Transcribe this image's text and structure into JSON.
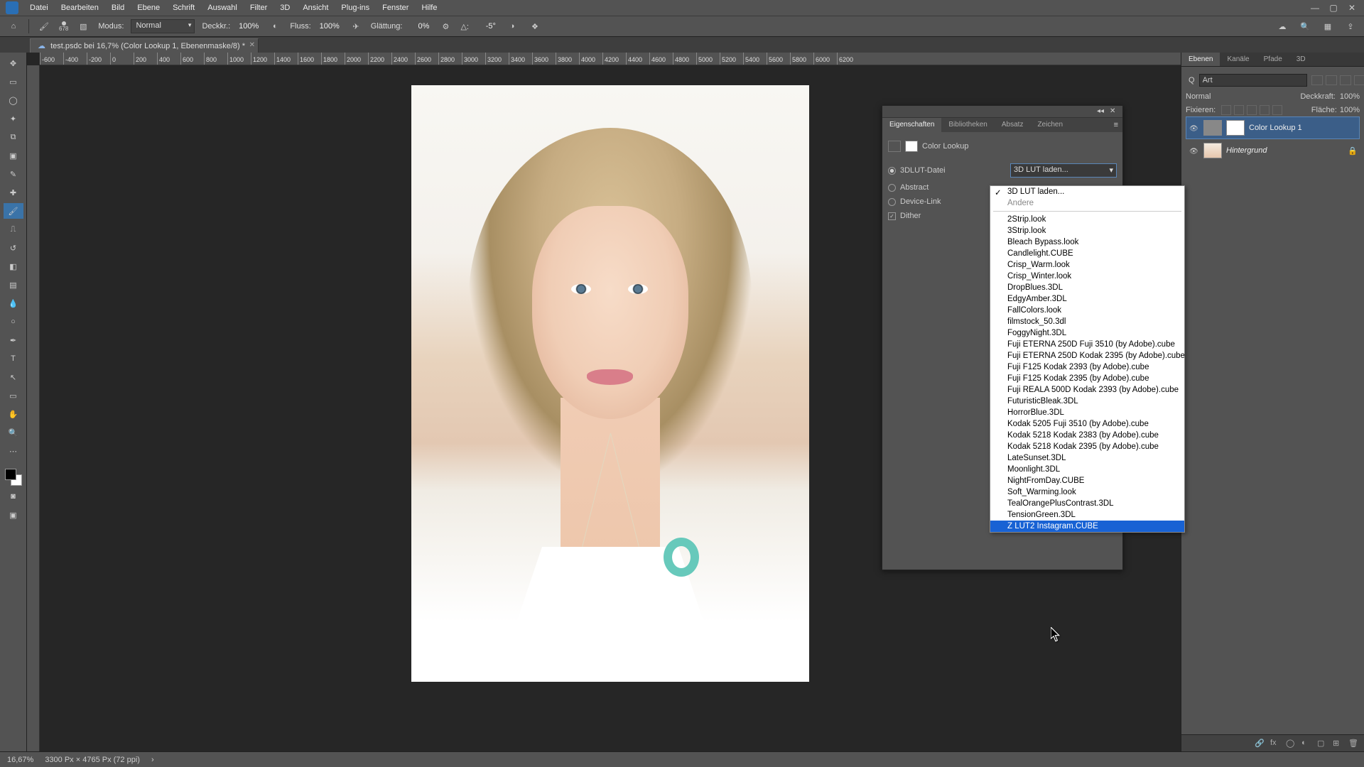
{
  "menu": [
    "Datei",
    "Bearbeiten",
    "Bild",
    "Ebene",
    "Schrift",
    "Auswahl",
    "Filter",
    "3D",
    "Ansicht",
    "Plug-ins",
    "Fenster",
    "Hilfe"
  ],
  "optbar": {
    "brush_size": "678",
    "modus_label": "Modus:",
    "modus_value": "Normal",
    "deckkr_label": "Deckkr.:",
    "deckkr_value": "100%",
    "fluss_label": "Fluss:",
    "fluss_value": "100%",
    "glatt_label": "Glättung:",
    "glatt_value": "0%",
    "angle_label": "△:",
    "angle_value": "-5°"
  },
  "doctab": {
    "title": "test.psdc bei 16,7% (Color Lookup 1, Ebenenmaske/8) *"
  },
  "ruler_ticks": [
    "-600",
    "-400",
    "-200",
    "0",
    "200",
    "400",
    "600",
    "800",
    "1000",
    "1200",
    "1400",
    "1600",
    "1800",
    "2000",
    "2200",
    "2400",
    "2600",
    "2800",
    "3000",
    "3200",
    "3400",
    "3600",
    "3800",
    "4000",
    "4200",
    "4400",
    "4600",
    "4800",
    "5000",
    "5200",
    "5400",
    "5600",
    "5800",
    "6000",
    "6200"
  ],
  "props": {
    "tab1": "Eigenschaften",
    "tab2": "Bibliotheken",
    "tab3": "Absatz",
    "tab4": "Zeichen",
    "title": "Color Lookup",
    "r1": "3DLUT-Datei",
    "r2": "Abstract",
    "r3": "Device-Link",
    "r4": "Dither",
    "dd_label": "3D LUT laden..."
  },
  "lut_menu": {
    "load": "3D LUT laden...",
    "other": "Andere",
    "items": [
      "2Strip.look",
      "3Strip.look",
      "Bleach Bypass.look",
      "Candlelight.CUBE",
      "Crisp_Warm.look",
      "Crisp_Winter.look",
      "DropBlues.3DL",
      "EdgyAmber.3DL",
      "FallColors.look",
      "filmstock_50.3dl",
      "FoggyNight.3DL",
      "Fuji ETERNA 250D Fuji 3510 (by Adobe).cube",
      "Fuji ETERNA 250D Kodak 2395 (by Adobe).cube",
      "Fuji F125 Kodak 2393 (by Adobe).cube",
      "Fuji F125 Kodak 2395 (by Adobe).cube",
      "Fuji REALA 500D Kodak 2393 (by Adobe).cube",
      "FuturisticBleak.3DL",
      "HorrorBlue.3DL",
      "Kodak 5205 Fuji 3510 (by Adobe).cube",
      "Kodak 5218 Kodak 2383 (by Adobe).cube",
      "Kodak 5218 Kodak 2395 (by Adobe).cube",
      "LateSunset.3DL",
      "Moonlight.3DL",
      "NightFromDay.CUBE",
      "Soft_Warming.look",
      "TealOrangePlusContrast.3DL",
      "TensionGreen.3DL",
      "Z LUT2 Instagram.CUBE"
    ],
    "highlight": "Z LUT2 Instagram.CUBE"
  },
  "layers": {
    "tab1": "Ebenen",
    "tab2": "Kanäle",
    "tab3": "Pfade",
    "tab4": "3D",
    "search_q": "Q",
    "search_label": "Art",
    "blend": "Normal",
    "opacity_label": "Deckkraft:",
    "opacity": "100%",
    "lock_label": "Fixieren:",
    "fill_label": "Fläche:",
    "fill": "100%",
    "layer1": "Color Lookup 1",
    "layer2": "Hintergrund"
  },
  "status": {
    "zoom": "16,67%",
    "doc": "3300 Px × 4765 Px (72 ppi)"
  }
}
